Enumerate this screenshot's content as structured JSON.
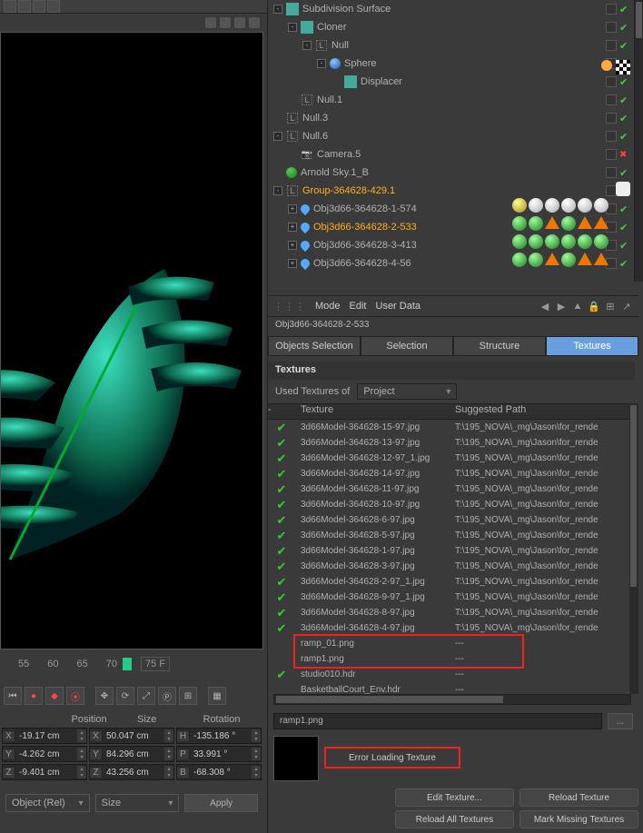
{
  "menus": {
    "mode": "Mode",
    "edit": "Edit",
    "userdata": "User Data"
  },
  "objPath": "Obj3d66-364628-2-533",
  "tabs": {
    "objsel": "Objects Selection",
    "sel": "Selection",
    "struct": "Structure",
    "tex": "Textures"
  },
  "section": {
    "title": "Textures",
    "usedLabel": "Used Textures of",
    "scope": "Project"
  },
  "texHeader": {
    "c1": "-",
    "c2": "Texture",
    "c3": "Suggested Path"
  },
  "tree": [
    {
      "indent": 0,
      "exp": "-",
      "icon": "cube",
      "label": "Subdivision Surface"
    },
    {
      "indent": 1,
      "exp": "-",
      "icon": "cube",
      "label": "Cloner"
    },
    {
      "indent": 2,
      "exp": "-",
      "icon": "null",
      "label": "Null"
    },
    {
      "indent": 3,
      "exp": "-",
      "icon": "sphere",
      "label": "Sphere"
    },
    {
      "indent": 4,
      "exp": "",
      "icon": "cube",
      "label": "Displacer"
    },
    {
      "indent": 1,
      "exp": "",
      "icon": "null",
      "label": "Null.1"
    },
    {
      "indent": 0,
      "exp": "",
      "icon": "null",
      "label": "Null.3"
    },
    {
      "indent": 0,
      "exp": "-",
      "icon": "null",
      "label": "Null.6"
    },
    {
      "indent": 1,
      "exp": "",
      "icon": "cam",
      "label": "Camera.5"
    },
    {
      "indent": 0,
      "exp": "",
      "icon": "earth",
      "label": "Arnold Sky.1_B"
    },
    {
      "indent": 0,
      "exp": "-",
      "icon": "grp",
      "label": "Group-364628-429.1",
      "sel": true
    },
    {
      "indent": 1,
      "exp": "+",
      "icon": "drop",
      "label": "Obj3d66-364628-1-574"
    },
    {
      "indent": 1,
      "exp": "+",
      "icon": "drop",
      "label": "Obj3d66-364628-2-533",
      "sel": true
    },
    {
      "indent": 1,
      "exp": "+",
      "icon": "drop",
      "label": "Obj3d66-364628-3-413"
    },
    {
      "indent": 1,
      "exp": "+",
      "icon": "drop",
      "label": "Obj3d66-364628-4-56"
    }
  ],
  "textures": [
    {
      "ok": true,
      "name": "3d66Model-364628-15-97.jpg",
      "path": "T:\\195_NOVA\\_mg\\Jason\\for_rende"
    },
    {
      "ok": true,
      "name": "3d66Model-364628-13-97.jpg",
      "path": "T:\\195_NOVA\\_mg\\Jason\\for_rende"
    },
    {
      "ok": true,
      "name": "3d66Model-364628-12-97_1.jpg",
      "path": "T:\\195_NOVA\\_mg\\Jason\\for_rende"
    },
    {
      "ok": true,
      "name": "3d66Model-364628-14-97.jpg",
      "path": "T:\\195_NOVA\\_mg\\Jason\\for_rende"
    },
    {
      "ok": true,
      "name": "3d66Model-364628-11-97.jpg",
      "path": "T:\\195_NOVA\\_mg\\Jason\\for_rende"
    },
    {
      "ok": true,
      "name": "3d66Model-364628-10-97.jpg",
      "path": "T:\\195_NOVA\\_mg\\Jason\\for_rende"
    },
    {
      "ok": true,
      "name": "3d66Model-364628-6-97.jpg",
      "path": "T:\\195_NOVA\\_mg\\Jason\\for_rende"
    },
    {
      "ok": true,
      "name": "3d66Model-364628-5-97.jpg",
      "path": "T:\\195_NOVA\\_mg\\Jason\\for_rende"
    },
    {
      "ok": true,
      "name": "3d66Model-364628-1-97.jpg",
      "path": "T:\\195_NOVA\\_mg\\Jason\\for_rende"
    },
    {
      "ok": true,
      "name": "3d66Model-364628-3-97.jpg",
      "path": "T:\\195_NOVA\\_mg\\Jason\\for_rende"
    },
    {
      "ok": true,
      "name": "3d66Model-364628-2-97_1.jpg",
      "path": "T:\\195_NOVA\\_mg\\Jason\\for_rende"
    },
    {
      "ok": true,
      "name": "3d66Model-364628-9-97_1.jpg",
      "path": "T:\\195_NOVA\\_mg\\Jason\\for_rende"
    },
    {
      "ok": true,
      "name": "3d66Model-364628-8-97.jpg",
      "path": "T:\\195_NOVA\\_mg\\Jason\\for_rende"
    },
    {
      "ok": true,
      "name": "3d66Model-364628-4-97.jpg",
      "path": "T:\\195_NOVA\\_mg\\Jason\\for_rende"
    },
    {
      "ok": false,
      "name": "ramp_01.png",
      "path": "---"
    },
    {
      "ok": false,
      "name": "ramp1.png",
      "path": "---"
    },
    {
      "ok": true,
      "name": "studio010.hdr",
      "path": "---"
    },
    {
      "ok": false,
      "name": "BasketballCourt_Env.hdr",
      "path": "---"
    }
  ],
  "preview": {
    "filename": "ramp1.png",
    "error": "Error Loading Texture"
  },
  "buttons": {
    "edit": "Edit Texture...",
    "reload": "Reload Texture",
    "reloadAll": "Reload All Textures",
    "mark": "Mark Missing Textures"
  },
  "ruler": {
    "t55": "55",
    "t60": "60",
    "t65": "65",
    "t70": "70",
    "frame": "75 F"
  },
  "coords": {
    "hPos": "Position",
    "hSize": "Size",
    "hRot": "Rotation",
    "r1": {
      "x": "-19.17 cm",
      "sx": "50.047 cm",
      "h": "-135.186 °"
    },
    "r2": {
      "y": "-4.262 cm",
      "sy": "84.296 cm",
      "p": "33.991 °"
    },
    "r3": {
      "z": "-9.401 cm",
      "sz": "43.256 cm",
      "b": "-68.308 °"
    }
  },
  "bottom": {
    "objrel": "Object (Rel)",
    "size": "Size",
    "apply": "Apply"
  },
  "labels": {
    "X": "X",
    "Y": "Y",
    "Z": "Z",
    "H": "H",
    "P": "P",
    "B": "B"
  }
}
